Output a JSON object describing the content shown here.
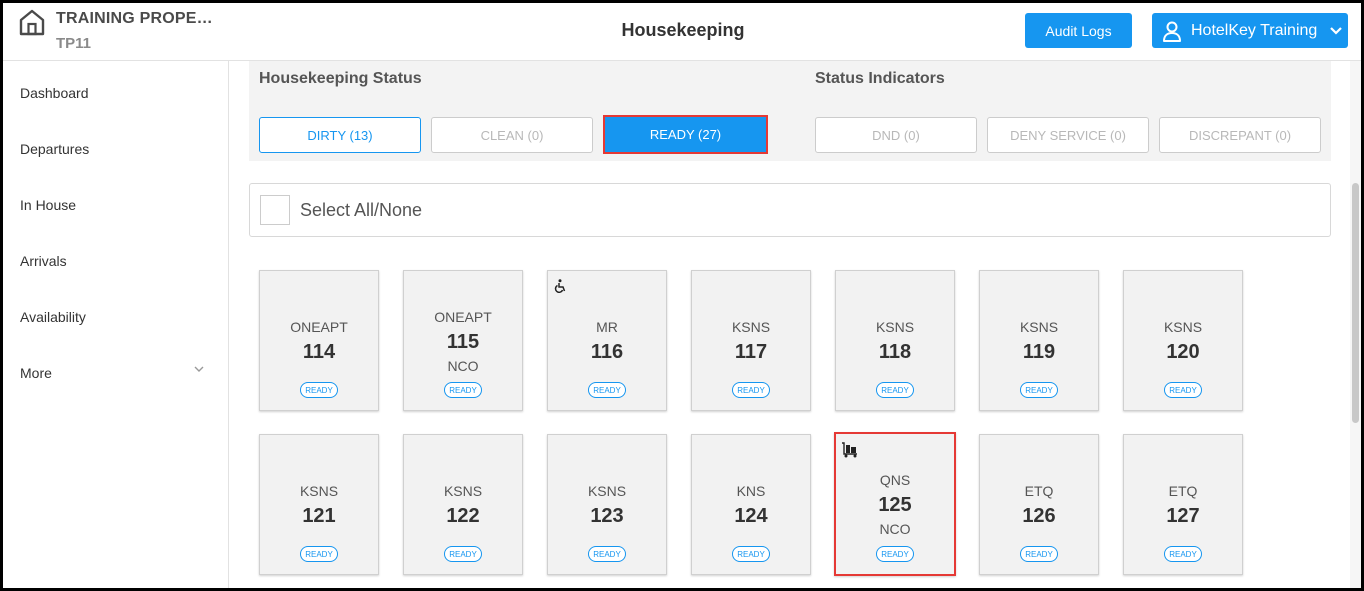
{
  "header": {
    "property_name": "TRAINING PROPE…",
    "property_code": "TP11",
    "title": "Housekeeping",
    "audit_label": "Audit Logs",
    "user_label": "HotelKey Training"
  },
  "sidebar": {
    "items": [
      {
        "label": "Dashboard"
      },
      {
        "label": "Departures"
      },
      {
        "label": "In House"
      },
      {
        "label": "Arrivals"
      },
      {
        "label": "Availability"
      },
      {
        "label": "More"
      }
    ]
  },
  "status_panel": {
    "hk_title": "Housekeeping Status",
    "ind_title": "Status Indicators",
    "buttons": [
      {
        "label": "DIRTY (13)"
      },
      {
        "label": "CLEAN (0)"
      },
      {
        "label": "READY (27)"
      },
      {
        "label": "DND (0)"
      },
      {
        "label": "DENY SERVICE (0)"
      },
      {
        "label": "DISCREPANT (0)"
      }
    ]
  },
  "select_all": {
    "label": "Select All/None"
  },
  "rooms": [
    {
      "type": "ONEAPT",
      "number": "114",
      "code": "",
      "status": "READY",
      "icon": ""
    },
    {
      "type": "ONEAPT",
      "number": "115",
      "code": "NCO",
      "status": "READY",
      "icon": ""
    },
    {
      "type": "MR",
      "number": "116",
      "code": "",
      "status": "READY",
      "icon": "wheelchair-icon"
    },
    {
      "type": "KSNS",
      "number": "117",
      "code": "",
      "status": "READY",
      "icon": ""
    },
    {
      "type": "KSNS",
      "number": "118",
      "code": "",
      "status": "READY",
      "icon": ""
    },
    {
      "type": "KSNS",
      "number": "119",
      "code": "",
      "status": "READY",
      "icon": ""
    },
    {
      "type": "KSNS",
      "number": "120",
      "code": "",
      "status": "READY",
      "icon": ""
    },
    {
      "type": "KSNS",
      "number": "121",
      "code": "",
      "status": "READY",
      "icon": ""
    },
    {
      "type": "KSNS",
      "number": "122",
      "code": "",
      "status": "READY",
      "icon": ""
    },
    {
      "type": "KSNS",
      "number": "123",
      "code": "",
      "status": "READY",
      "icon": ""
    },
    {
      "type": "KNS",
      "number": "124",
      "code": "",
      "status": "READY",
      "icon": ""
    },
    {
      "type": "QNS",
      "number": "125",
      "code": "NCO",
      "status": "READY",
      "icon": "luggage-cart-icon"
    },
    {
      "type": "ETQ",
      "number": "126",
      "code": "",
      "status": "READY",
      "icon": ""
    },
    {
      "type": "ETQ",
      "number": "127",
      "code": "",
      "status": "READY",
      "icon": ""
    }
  ],
  "colors": {
    "accent": "#1696f0",
    "highlight": "#e53935",
    "panel_bg": "#f3f3f3"
  }
}
